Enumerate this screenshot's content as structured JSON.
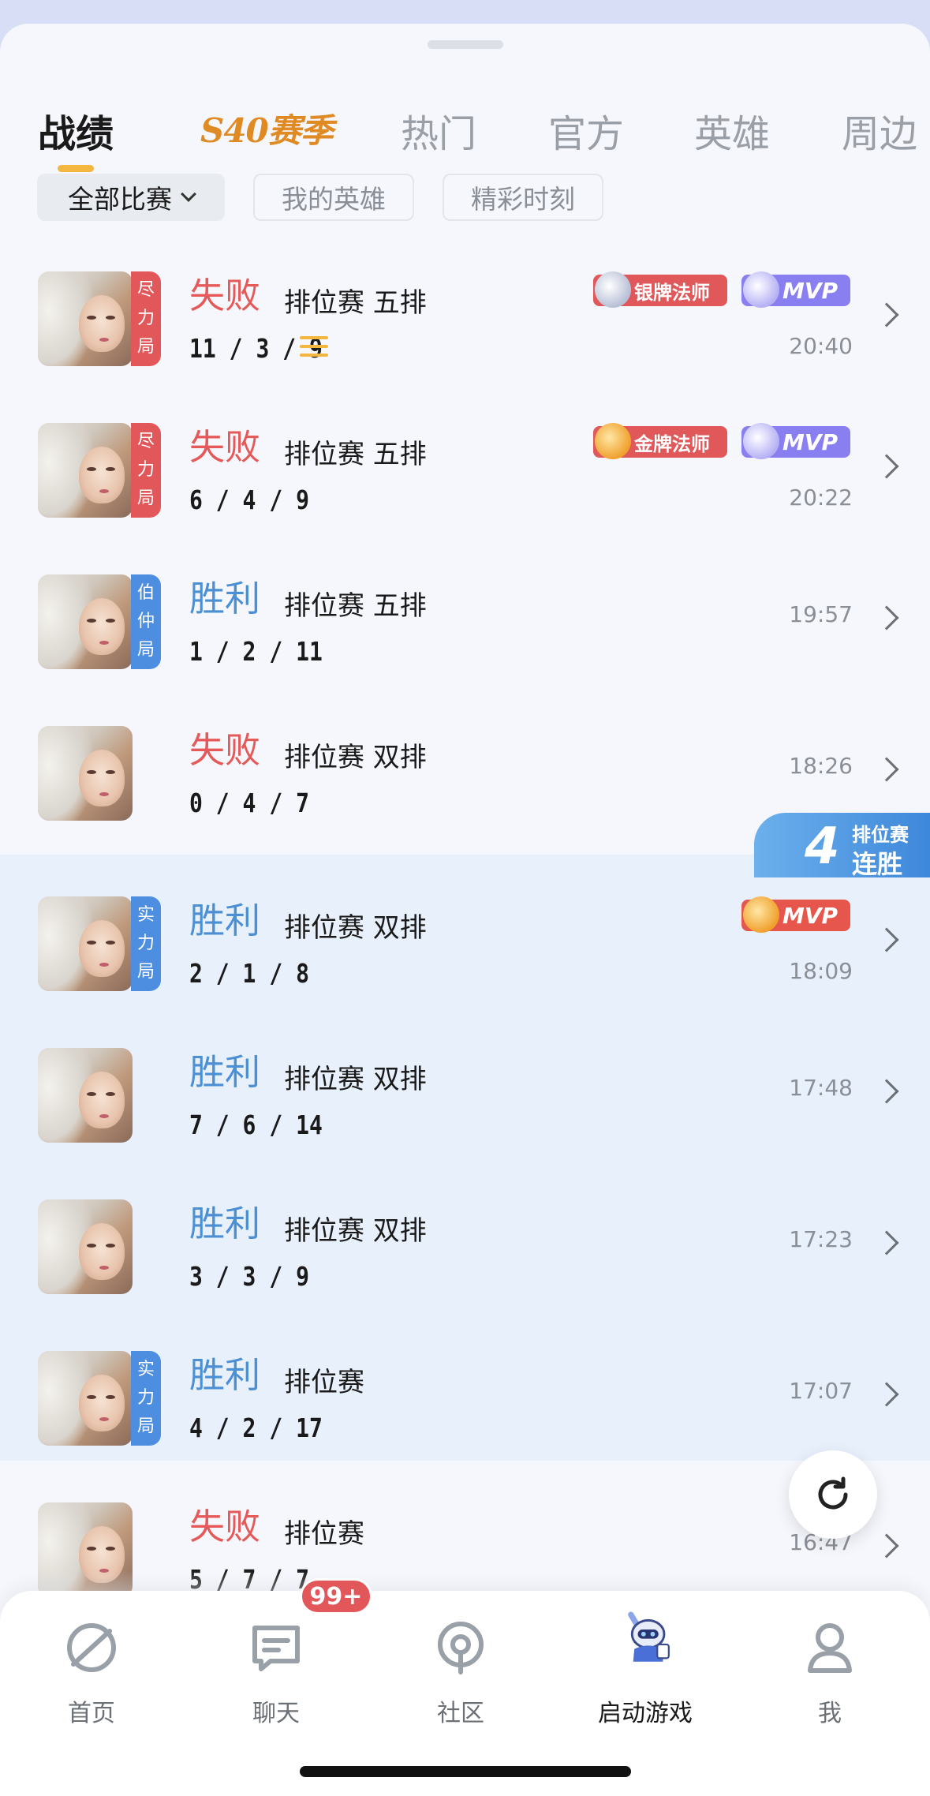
{
  "tabs": [
    {
      "label": "战绩",
      "active": true
    },
    {
      "label": "S40赛季"
    },
    {
      "label": "热门"
    },
    {
      "label": "官方"
    },
    {
      "label": "英雄"
    },
    {
      "label": "周边"
    }
  ],
  "filters": {
    "all": "全部比赛",
    "my_heroes": "我的英雄",
    "highlights": "精彩时刻"
  },
  "matches": [
    {
      "result": "失败",
      "mode": "排位赛 五排",
      "kda": "11 / 3 / 9",
      "time": "20:40",
      "tag": "尽力局",
      "badge": "银牌法师",
      "mvp": "MVP"
    },
    {
      "result": "失败",
      "mode": "排位赛 五排",
      "kda": "6 / 4 / 9",
      "time": "20:22",
      "tag": "尽力局",
      "badge": "金牌法师",
      "mvp": "MVP"
    },
    {
      "result": "胜利",
      "mode": "排位赛 五排",
      "kda": "1 / 2 / 11",
      "time": "19:57",
      "tag": "伯仲局"
    },
    {
      "result": "失败",
      "mode": "排位赛 双排",
      "kda": "0 / 4 / 7",
      "time": "18:26"
    },
    {
      "result": "胜利",
      "mode": "排位赛 双排",
      "kda": "2 / 1 / 8",
      "time": "18:09",
      "tag": "实力局",
      "mvp": "MVP"
    },
    {
      "result": "胜利",
      "mode": "排位赛 双排",
      "kda": "7 / 6 / 14",
      "time": "17:48"
    },
    {
      "result": "胜利",
      "mode": "排位赛 双排",
      "kda": "3 / 3 / 9",
      "time": "17:23"
    },
    {
      "result": "胜利",
      "mode": "排位赛",
      "kda": "4 / 2 / 17",
      "time": "17:07",
      "tag": "实力局"
    },
    {
      "result": "失败",
      "mode": "排位赛",
      "kda": "5 / 7 / 7",
      "time": "16:47"
    }
  ],
  "streak": {
    "count": "4",
    "line1": "排位赛",
    "line2": "连胜"
  },
  "nav": {
    "items": [
      {
        "label": "首页",
        "icon": "home-icon"
      },
      {
        "label": "聊天",
        "icon": "chat-icon"
      },
      {
        "label": "社区",
        "icon": "community-icon"
      },
      {
        "label": "启动游戏",
        "icon": "launch-game-icon"
      },
      {
        "label": "我",
        "icon": "profile-icon"
      }
    ],
    "chat_badge": "99+"
  },
  "colors": {
    "lose": "#e55a58",
    "win": "#4b8fd4",
    "accent": "#f3b740"
  }
}
